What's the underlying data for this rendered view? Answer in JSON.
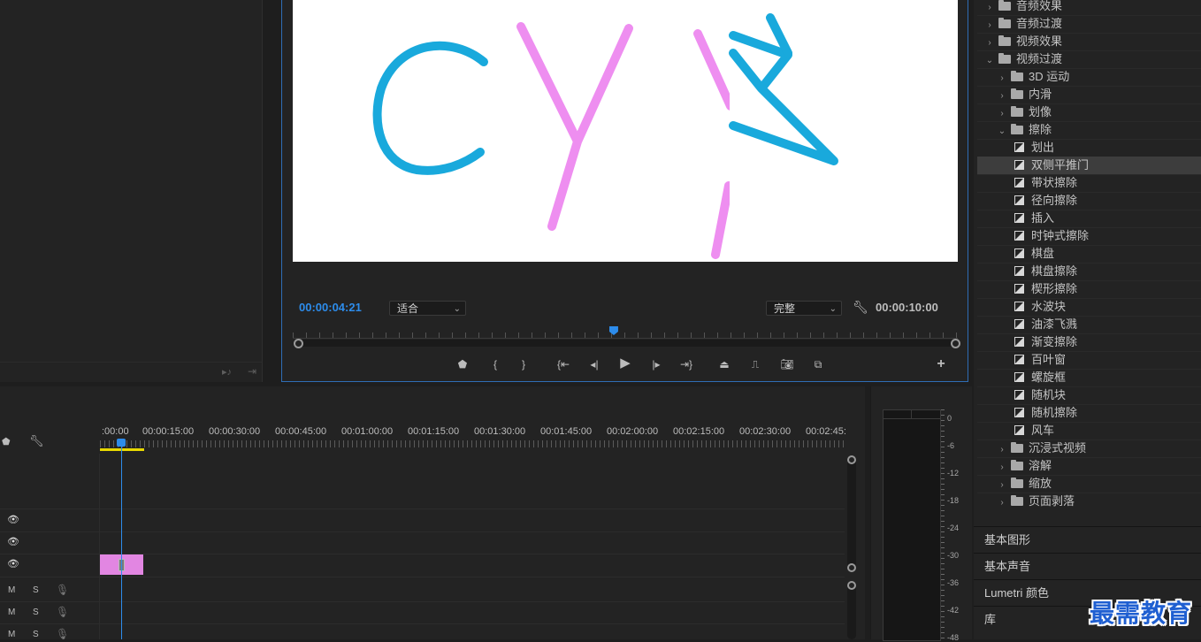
{
  "program": {
    "timecode": "00:00:04:21",
    "fit_label": "适合",
    "quality_label": "完整",
    "duration": "00:00:10:00",
    "playhead_progress": 0.48
  },
  "video_text": [
    "C",
    "Y",
    "\\",
    "爱"
  ],
  "effects": {
    "rows": [
      {
        "label": "音频效果",
        "type": "folder",
        "level": 0,
        "expanded": false
      },
      {
        "label": "音频过渡",
        "type": "folder",
        "level": 0,
        "expanded": false
      },
      {
        "label": "视频效果",
        "type": "folder",
        "level": 0,
        "expanded": false
      },
      {
        "label": "视频过渡",
        "type": "folder",
        "level": 0,
        "expanded": true
      },
      {
        "label": "3D 运动",
        "type": "folder",
        "level": 1,
        "expanded": false
      },
      {
        "label": "内滑",
        "type": "folder",
        "level": 1,
        "expanded": false
      },
      {
        "label": "划像",
        "type": "folder",
        "level": 1,
        "expanded": false
      },
      {
        "label": "擦除",
        "type": "folder",
        "level": 1,
        "expanded": true
      },
      {
        "label": "划出",
        "type": "effect",
        "level": 2
      },
      {
        "label": "双侧平推门",
        "type": "effect",
        "level": 2,
        "selected": true
      },
      {
        "label": "带状擦除",
        "type": "effect",
        "level": 2
      },
      {
        "label": "径向擦除",
        "type": "effect",
        "level": 2
      },
      {
        "label": "插入",
        "type": "effect",
        "level": 2
      },
      {
        "label": "时钟式擦除",
        "type": "effect",
        "level": 2
      },
      {
        "label": "棋盘",
        "type": "effect",
        "level": 2
      },
      {
        "label": "棋盘擦除",
        "type": "effect",
        "level": 2
      },
      {
        "label": "楔形擦除",
        "type": "effect",
        "level": 2
      },
      {
        "label": "水波块",
        "type": "effect",
        "level": 2
      },
      {
        "label": "油漆飞溅",
        "type": "effect",
        "level": 2
      },
      {
        "label": "渐变擦除",
        "type": "effect",
        "level": 2
      },
      {
        "label": "百叶窗",
        "type": "effect",
        "level": 2
      },
      {
        "label": "螺旋框",
        "type": "effect",
        "level": 2
      },
      {
        "label": "随机块",
        "type": "effect",
        "level": 2
      },
      {
        "label": "随机擦除",
        "type": "effect",
        "level": 2
      },
      {
        "label": "风车",
        "type": "effect",
        "level": 2
      },
      {
        "label": "沉浸式视频",
        "type": "folder",
        "level": 1,
        "expanded": false
      },
      {
        "label": "溶解",
        "type": "folder",
        "level": 1,
        "expanded": false
      },
      {
        "label": "缩放",
        "type": "folder",
        "level": 1,
        "expanded": false
      },
      {
        "label": "页面剥落",
        "type": "folder",
        "level": 1,
        "expanded": false
      }
    ],
    "sections": [
      "基本图形",
      "基本声音",
      "Lumetri 颜色",
      "库"
    ]
  },
  "timeline": {
    "ruler": [
      ":00:00",
      "00:00:15:00",
      "00:00:30:00",
      "00:00:45:00",
      "00:01:00:00",
      "00:01:15:00",
      "00:01:30:00",
      "00:01:45:00",
      "00:02:00:00",
      "00:02:15:00",
      "00:02:30:00",
      "00:02:45:"
    ],
    "audio_track_labels": {
      "m": "M",
      "s": "S"
    }
  },
  "meter": {
    "db_labels": [
      "0",
      "-6",
      "-12",
      "-18",
      "-24",
      "-30",
      "-36",
      "-42",
      "-48"
    ]
  },
  "watermark": "最需教育",
  "colors": {
    "accent": "#2d8ceb",
    "clip": "#e286e2",
    "stroke_blue": "#19a9dc",
    "stroke_pink": "#ee8ef0",
    "work_area": "#e8d800"
  }
}
